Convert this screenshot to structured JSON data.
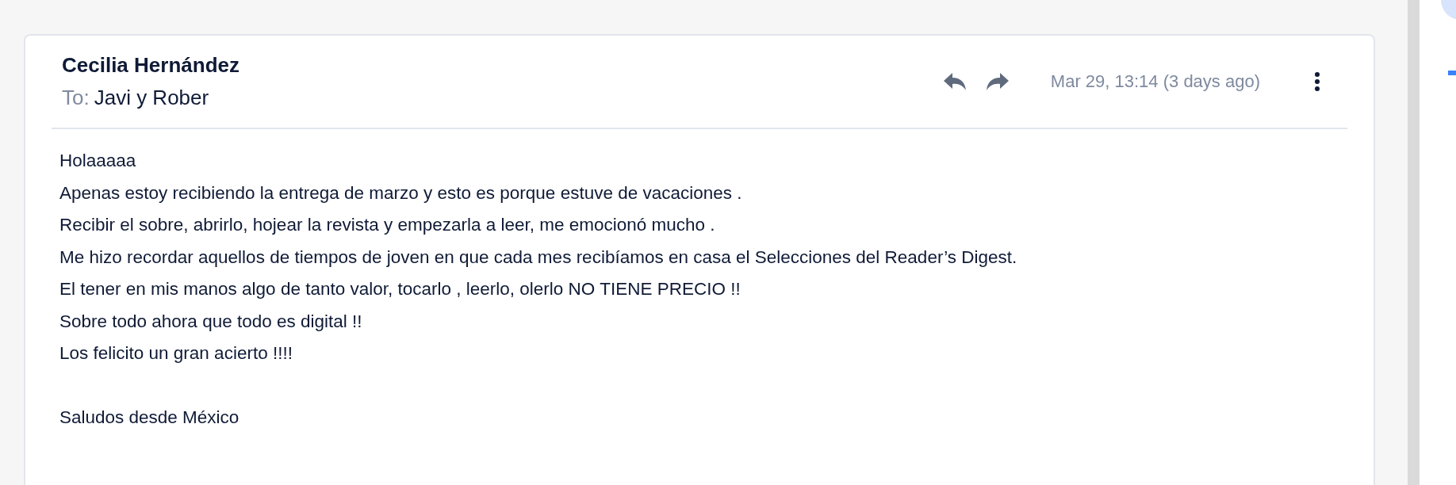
{
  "message": {
    "sender": "Cecilia Hernández",
    "to_label": "To:",
    "recipient": "Javi y Rober",
    "date": "Mar 29, 13:14 (3 days ago)",
    "body": [
      "Holaaaaa",
      "Apenas estoy recibiendo la entrega de marzo y esto es porque estuve de vacaciones .",
      "Recibir el sobre, abrirlo, hojear la revista y empezarla a leer, me emocionó mucho .",
      "Me hizo recordar aquellos de tiempos de joven en que cada mes recibíamos en casa el Selecciones del Reader’s Digest.",
      "El tener en mis manos algo de tanto valor, tocarlo , leerlo, olerlo  NO TIENE PRECIO !!",
      "Sobre todo ahora que todo es digital !!",
      "Los felicito un gran acierto !!!!"
    ],
    "closing": "Saludos desde México"
  }
}
